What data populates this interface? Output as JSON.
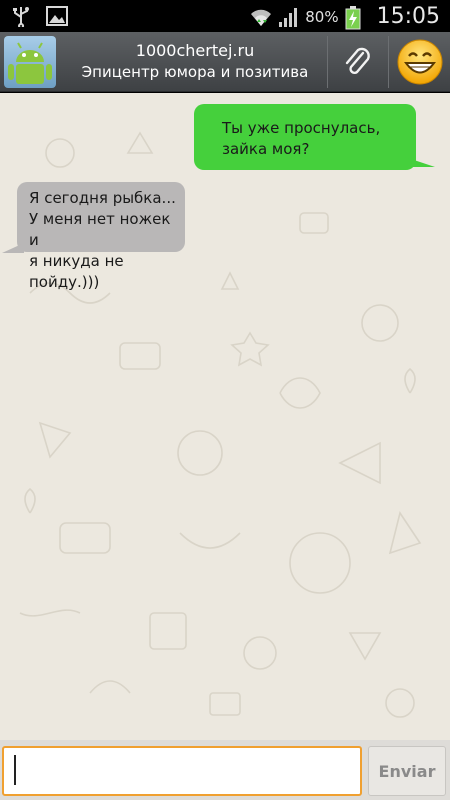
{
  "status_bar": {
    "battery_percent": "80%",
    "time": "15:05",
    "icons": [
      "usb-icon",
      "image-icon",
      "wifi-icon",
      "signal-icon",
      "battery-charging-icon"
    ]
  },
  "header": {
    "title": "1000chertej.ru",
    "subtitle": "Эпицентр юмора и позитива",
    "avatar_icon": "android-robot-icon",
    "attach_icon": "paperclip-icon",
    "emoji_icon": "grinning-smiley-icon"
  },
  "messages": [
    {
      "direction": "outgoing",
      "text": "Ты уже проснулась,\nзайка моя?"
    },
    {
      "direction": "incoming",
      "text": "Я сегодня рыбка...\nУ меня нет ножек и\nя никуда не пойду.)))"
    }
  ],
  "composer": {
    "value": "",
    "placeholder": "",
    "send_label": "Enviar"
  },
  "colors": {
    "outgoing_bubble": "#45d03c",
    "incoming_bubble": "#b9b7b7",
    "chat_background": "#ece8df",
    "input_focus_border": "#f0a030"
  }
}
